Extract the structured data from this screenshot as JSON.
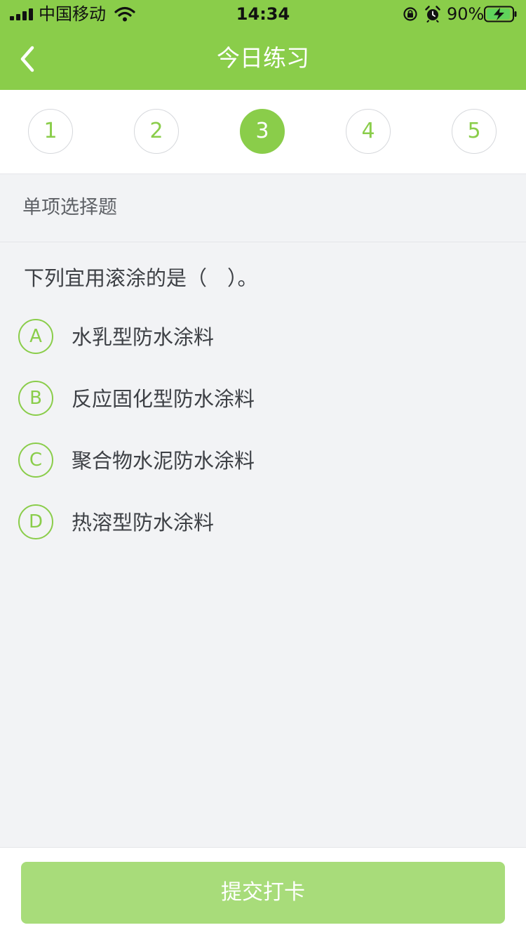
{
  "status_bar": {
    "carrier": "中国移动",
    "time": "14:34",
    "battery": "90%",
    "signal_icon": "signal-bars-icon",
    "wifi_icon": "wifi-icon",
    "lock_icon": "rotation-lock-icon",
    "alarm_icon": "alarm-clock-icon",
    "battery_icon": "battery-charging-icon"
  },
  "header": {
    "title": "今日练习",
    "back_icon": "chevron-left-icon"
  },
  "steps": {
    "items": [
      "1",
      "2",
      "3",
      "4",
      "5"
    ],
    "current": "3"
  },
  "question": {
    "type_label": "单项选择题",
    "text": "下列宜用滚涂的是（　）。",
    "options": [
      {
        "letter": "A",
        "text": "水乳型防水涂料"
      },
      {
        "letter": "B",
        "text": "反应固化型防水涂料"
      },
      {
        "letter": "C",
        "text": "聚合物水泥防水涂料"
      },
      {
        "letter": "D",
        "text": "热溶型防水涂料"
      }
    ]
  },
  "footer": {
    "submit_label": "提交打卡"
  },
  "colors": {
    "brand": "#8acd4a",
    "submit_disabled": "#a8dc7a",
    "background": "#f2f3f5",
    "text": "#3d4045"
  }
}
